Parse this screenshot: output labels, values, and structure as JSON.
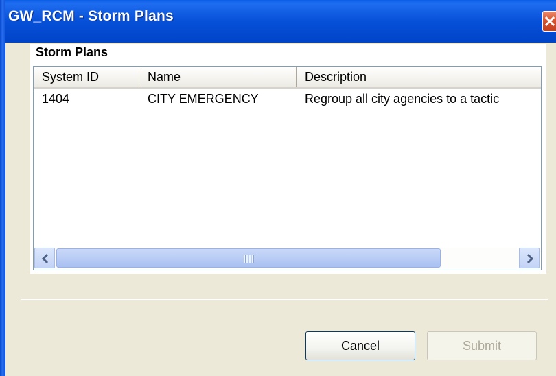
{
  "window": {
    "title": "GW_RCM - Storm Plans"
  },
  "group": {
    "title": "Storm Plans"
  },
  "listview": {
    "columns": [
      "System ID",
      "Name",
      "Description"
    ],
    "rows": [
      [
        "1404",
        "CITY EMERGENCY",
        "Regroup all city agencies to a tactic"
      ]
    ]
  },
  "buttons": {
    "cancel": "Cancel",
    "submit": "Submit",
    "submit_enabled": false
  },
  "icons": {
    "close": "close-icon",
    "scroll_left": "scroll-left-arrow-icon",
    "scroll_right": "scroll-right-arrow-icon"
  },
  "colors": {
    "titlebar": "#0650d8",
    "close_button": "#d8532f",
    "window_background": "#ece9d8",
    "scrollbar_thumb": "#b9cdf5"
  }
}
